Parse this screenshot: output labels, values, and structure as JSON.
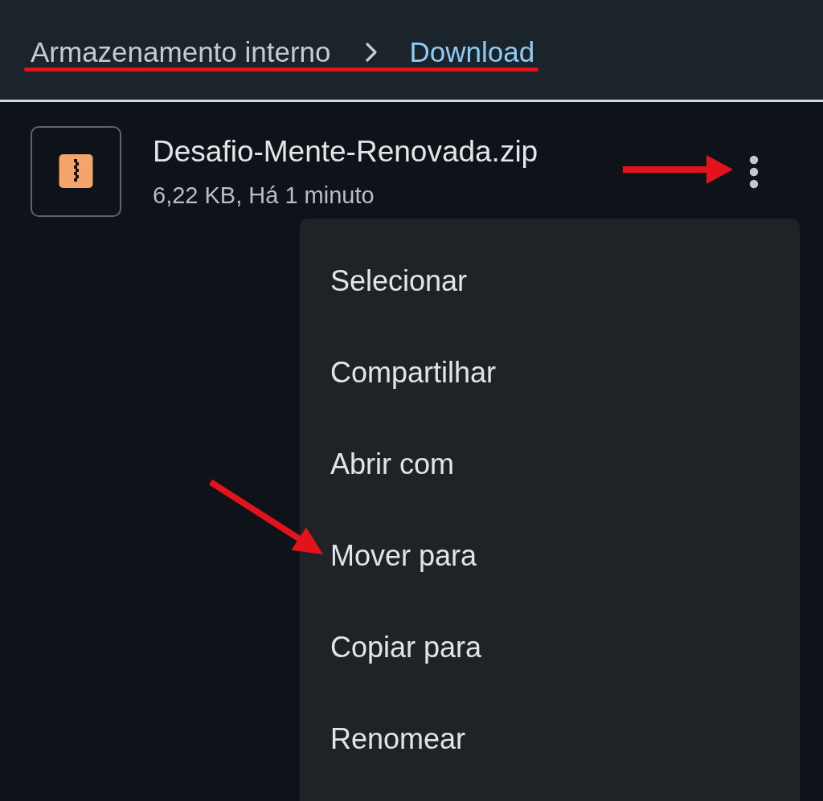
{
  "breadcrumb": [
    {
      "label": "Armazenamento interno",
      "current": false
    },
    {
      "label": "Download",
      "current": true
    }
  ],
  "files": [
    {
      "kind": "zip",
      "name": "Desafio-Mente-Renovada.zip",
      "details": "6,22 KB, Há 1 minuto"
    }
  ],
  "context_menu": {
    "items": [
      "Selecionar",
      "Compartilhar",
      "Abrir com",
      "Mover para",
      "Copiar para",
      "Renomear"
    ]
  }
}
